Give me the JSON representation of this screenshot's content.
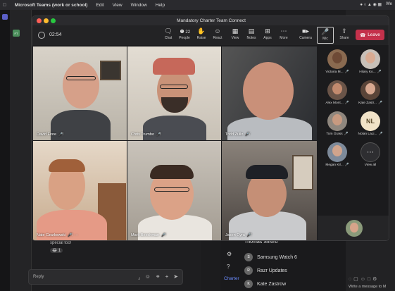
{
  "menubar": {
    "app_name": "Microsoft Teams (work or school)",
    "items": [
      "Edit",
      "View",
      "Window",
      "Help"
    ],
    "clock": "We"
  },
  "meeting": {
    "title": "Mandatory Charter Team Connect",
    "timer": "02:54",
    "toolbar": {
      "chat": "Chat",
      "people": "People",
      "people_count": "22",
      "raise": "Raise",
      "react": "React",
      "view": "View",
      "notes": "Notes",
      "apps": "Apps",
      "more": "More",
      "camera": "Camera",
      "mic": "Mic",
      "share": "Share",
      "leave": "Leave"
    },
    "participants": [
      {
        "name": "David Fiore"
      },
      {
        "name": "Chris Trumbo"
      },
      {
        "name": "Todd Zullo"
      },
      {
        "name": "Nate Czarkowski"
      },
      {
        "name": "Mark Beechman"
      },
      {
        "name": "Jason Cyra"
      }
    ],
    "roster": [
      {
        "name": "Victoria M..."
      },
      {
        "name": "Hilary Ko..."
      },
      {
        "name": "Alex Mont..."
      },
      {
        "name": "Kate Zastr..."
      },
      {
        "name": "Tom Grass"
      },
      {
        "name": "Nolan LaLi...",
        "initials": "NL"
      },
      {
        "name": "Megan Kil..."
      },
      {
        "name": "View all"
      }
    ]
  },
  "background": {
    "reply_placeholder": "Reply",
    "special_text": "special too!",
    "reaction_count": "1",
    "chat_list": [
      {
        "name": "Thomas Sifford",
        "initial": ""
      },
      {
        "name": "Samsung Watch 6",
        "initial": "S"
      },
      {
        "name": "Razr Updates",
        "initial": "R"
      },
      {
        "name": "Kate Zastrow",
        "initial": "K"
      }
    ],
    "charter": "Charter",
    "compose_placeholder": "Write a message to M"
  },
  "colors": {
    "leave": "#c4314b",
    "active_speaker": "#5b5fc7"
  }
}
